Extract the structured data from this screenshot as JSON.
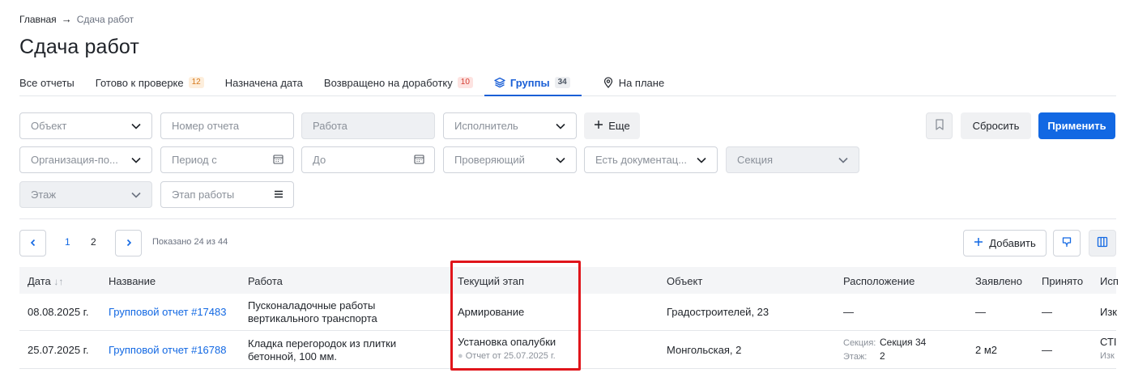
{
  "breadcrumb": {
    "home": "Главная",
    "current": "Сдача работ"
  },
  "page_title": "Сдача работ",
  "tabs": [
    {
      "label": "Все отчеты",
      "badge": ""
    },
    {
      "label": "Готово к проверке",
      "badge": "12"
    },
    {
      "label": "Назначена дата",
      "badge": ""
    },
    {
      "label": "Возвращено на доработку",
      "badge": "10"
    },
    {
      "label": "Группы",
      "badge": "34",
      "active": true
    },
    {
      "label": "На плане",
      "badge": ""
    }
  ],
  "filters": {
    "object": "Объект",
    "report_number": "Номер отчета",
    "work": "Работа",
    "executor": "Исполнитель",
    "more": "Еще",
    "organization": "Организация-по...",
    "period_from": "Период с",
    "period_to": "До",
    "reviewer": "Проверяющий",
    "has_docs": "Есть документац...",
    "section": "Секция",
    "floor": "Этаж",
    "stage": "Этап работы",
    "reset": "Сбросить",
    "apply": "Применить"
  },
  "pager": {
    "page1": "1",
    "page2": "2",
    "shown": "Показано 24 из 44"
  },
  "toolbar": {
    "add": "Добавить"
  },
  "table": {
    "headers": {
      "date": "Дата",
      "name": "Название",
      "work": "Работа",
      "stage": "Текущий этап",
      "object": "Объект",
      "location": "Расположение",
      "declared": "Заявлено",
      "accepted": "Принято",
      "executor": "Исп"
    },
    "rows": [
      {
        "date": "08.08.2025 г.",
        "name": "Групповой отчет #17483",
        "work_l1": "Пусконаладочные работы",
        "work_l2": "вертикального транспорта",
        "stage": "Армирование",
        "stage_sub": "",
        "object": "Градостроителей, 23",
        "location": "—",
        "declared": "—",
        "accepted": "—",
        "executor": "Изк"
      },
      {
        "date": "25.07.2025 г.",
        "name": "Групповой отчет #16788",
        "work_l1": "Кладка перегородок из плитки",
        "work_l2": "бетонной, 100 мм.",
        "stage": "Установка опалубки",
        "stage_sub": "Отчет от 25.07.2025 г.",
        "object": "Монгольская, 2",
        "section_key": "Секция:",
        "section_val": "Секция 34",
        "floor_key": "Этаж:",
        "floor_val": "2",
        "declared": "2 м2",
        "accepted": "—",
        "executor": "СТІ",
        "executor_sub": "Изк"
      }
    ]
  },
  "colors": {
    "accent": "#1268e3",
    "highlight": "#e0151b"
  }
}
